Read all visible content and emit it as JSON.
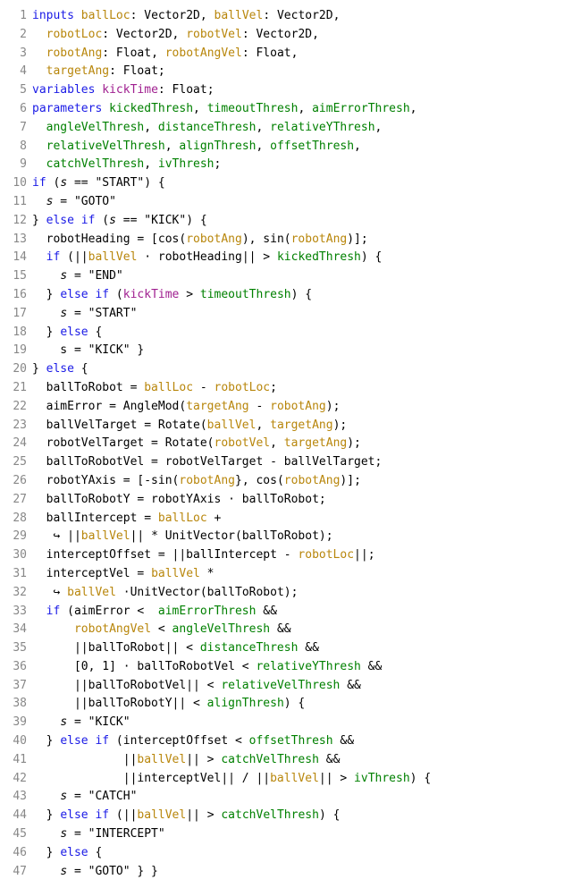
{
  "lines": [
    {
      "n": "1",
      "tokens": [
        [
          "kw",
          "inputs"
        ],
        [
          "txt",
          " "
        ],
        [
          "name",
          "ballLoc"
        ],
        [
          "txt",
          ": Vector2D, "
        ],
        [
          "name",
          "ballVel"
        ],
        [
          "txt",
          ": Vector2D,"
        ]
      ]
    },
    {
      "n": "2",
      "tokens": [
        [
          "txt",
          "  "
        ],
        [
          "name",
          "robotLoc"
        ],
        [
          "txt",
          ": Vector2D, "
        ],
        [
          "name",
          "robotVel"
        ],
        [
          "txt",
          ": Vector2D,"
        ]
      ]
    },
    {
      "n": "3",
      "tokens": [
        [
          "txt",
          "  "
        ],
        [
          "name",
          "robotAng"
        ],
        [
          "txt",
          ": Float, "
        ],
        [
          "name",
          "robotAngVel"
        ],
        [
          "txt",
          ": Float,"
        ]
      ]
    },
    {
      "n": "4",
      "tokens": [
        [
          "txt",
          "  "
        ],
        [
          "name",
          "targetAng"
        ],
        [
          "txt",
          ": Float;"
        ]
      ]
    },
    {
      "n": "5",
      "tokens": [
        [
          "kw",
          "variables"
        ],
        [
          "txt",
          " "
        ],
        [
          "var",
          "kickTime"
        ],
        [
          "txt",
          ": Float;"
        ]
      ]
    },
    {
      "n": "6",
      "tokens": [
        [
          "kw",
          "parameters"
        ],
        [
          "txt",
          " "
        ],
        [
          "param",
          "kickedThresh"
        ],
        [
          "txt",
          ", "
        ],
        [
          "param",
          "timeoutThresh"
        ],
        [
          "txt",
          ", "
        ],
        [
          "param",
          "aimErrorThresh"
        ],
        [
          "txt",
          ","
        ]
      ]
    },
    {
      "n": "7",
      "tokens": [
        [
          "txt",
          "  "
        ],
        [
          "param",
          "angleVelThresh"
        ],
        [
          "txt",
          ", "
        ],
        [
          "param",
          "distanceThresh"
        ],
        [
          "txt",
          ", "
        ],
        [
          "param",
          "relativeYThresh"
        ],
        [
          "txt",
          ","
        ]
      ]
    },
    {
      "n": "8",
      "tokens": [
        [
          "txt",
          "  "
        ],
        [
          "param",
          "relativeVelThresh"
        ],
        [
          "txt",
          ", "
        ],
        [
          "param",
          "alignThresh"
        ],
        [
          "txt",
          ", "
        ],
        [
          "param",
          "offsetThresh"
        ],
        [
          "txt",
          ","
        ]
      ]
    },
    {
      "n": "9",
      "tokens": [
        [
          "txt",
          "  "
        ],
        [
          "param",
          "catchVelThresh"
        ],
        [
          "txt",
          ", "
        ],
        [
          "param",
          "ivThresh"
        ],
        [
          "txt",
          ";"
        ]
      ]
    },
    {
      "n": "10",
      "tokens": [
        [
          "kw",
          "if"
        ],
        [
          "txt",
          " ("
        ],
        [
          "it",
          "s"
        ],
        [
          "txt",
          " == \"START\") {"
        ]
      ]
    },
    {
      "n": "11",
      "tokens": [
        [
          "txt",
          "  "
        ],
        [
          "it",
          "s"
        ],
        [
          "txt",
          " = \"GOTO\""
        ]
      ]
    },
    {
      "n": "12",
      "tokens": [
        [
          "txt",
          "} "
        ],
        [
          "kw",
          "else if"
        ],
        [
          "txt",
          " ("
        ],
        [
          "it",
          "s"
        ],
        [
          "txt",
          " == \"KICK\") {"
        ]
      ]
    },
    {
      "n": "13",
      "tokens": [
        [
          "txt",
          "  robotHeading = [cos("
        ],
        [
          "name",
          "robotAng"
        ],
        [
          "txt",
          "), sin("
        ],
        [
          "name",
          "robotAng"
        ],
        [
          "txt",
          ")];"
        ]
      ]
    },
    {
      "n": "14",
      "tokens": [
        [
          "txt",
          "  "
        ],
        [
          "kw",
          "if"
        ],
        [
          "txt",
          " (||"
        ],
        [
          "name",
          "ballVel"
        ],
        [
          "txt",
          " · robotHeading|| > "
        ],
        [
          "param",
          "kickedThresh"
        ],
        [
          "txt",
          ") {"
        ]
      ]
    },
    {
      "n": "15",
      "tokens": [
        [
          "txt",
          "    "
        ],
        [
          "it",
          "s"
        ],
        [
          "txt",
          " = \"END\""
        ]
      ]
    },
    {
      "n": "16",
      "tokens": [
        [
          "txt",
          "  } "
        ],
        [
          "kw",
          "else if"
        ],
        [
          "txt",
          " ("
        ],
        [
          "var",
          "kickTime"
        ],
        [
          "txt",
          " > "
        ],
        [
          "param",
          "timeoutThresh"
        ],
        [
          "txt",
          ") {"
        ]
      ]
    },
    {
      "n": "17",
      "tokens": [
        [
          "txt",
          "    "
        ],
        [
          "it",
          "s"
        ],
        [
          "txt",
          " = \"START\""
        ]
      ]
    },
    {
      "n": "18",
      "tokens": [
        [
          "txt",
          "  } "
        ],
        [
          "kw",
          "else"
        ],
        [
          "txt",
          " {"
        ]
      ]
    },
    {
      "n": "19",
      "tokens": [
        [
          "txt",
          "    s = \"KICK\" }"
        ]
      ]
    },
    {
      "n": "20",
      "tokens": [
        [
          "txt",
          "} "
        ],
        [
          "kw",
          "else"
        ],
        [
          "txt",
          " {"
        ]
      ]
    },
    {
      "n": "21",
      "tokens": [
        [
          "txt",
          "  ballToRobot = "
        ],
        [
          "name",
          "ballLoc"
        ],
        [
          "txt",
          " - "
        ],
        [
          "name",
          "robotLoc"
        ],
        [
          "txt",
          ";"
        ]
      ]
    },
    {
      "n": "22",
      "tokens": [
        [
          "txt",
          "  aimError = AngleMod("
        ],
        [
          "name",
          "targetAng"
        ],
        [
          "txt",
          " - "
        ],
        [
          "name",
          "robotAng"
        ],
        [
          "txt",
          ");"
        ]
      ]
    },
    {
      "n": "23",
      "tokens": [
        [
          "txt",
          "  ballVelTarget = Rotate("
        ],
        [
          "name",
          "ballVel"
        ],
        [
          "txt",
          ", "
        ],
        [
          "name",
          "targetAng"
        ],
        [
          "txt",
          ");"
        ]
      ]
    },
    {
      "n": "24",
      "tokens": [
        [
          "txt",
          "  robotVelTarget = Rotate("
        ],
        [
          "name",
          "robotVel"
        ],
        [
          "txt",
          ", "
        ],
        [
          "name",
          "targetAng"
        ],
        [
          "txt",
          ");"
        ]
      ]
    },
    {
      "n": "25",
      "tokens": [
        [
          "txt",
          "  ballToRobotVel = robotVelTarget - ballVelTarget;"
        ]
      ]
    },
    {
      "n": "26",
      "tokens": [
        [
          "txt",
          "  robotYAxis = [-sin("
        ],
        [
          "name",
          "robotAng"
        ],
        [
          "txt",
          "}, cos("
        ],
        [
          "name",
          "robotAng"
        ],
        [
          "txt",
          ")];"
        ]
      ]
    },
    {
      "n": "27",
      "tokens": [
        [
          "txt",
          "  ballToRobotY = robotYAxis · ballToRobot;"
        ]
      ]
    },
    {
      "n": "28",
      "tokens": [
        [
          "txt",
          "  ballIntercept = "
        ],
        [
          "name",
          "ballLoc"
        ],
        [
          "txt",
          " +"
        ]
      ]
    },
    {
      "n": "29",
      "tokens": [
        [
          "txt",
          "   ↪ ||"
        ],
        [
          "name",
          "ballVel"
        ],
        [
          "txt",
          "|| * UnitVector(ballToRobot);"
        ]
      ]
    },
    {
      "n": "30",
      "tokens": [
        [
          "txt",
          "  interceptOffset = ||ballIntercept - "
        ],
        [
          "name",
          "robotLoc"
        ],
        [
          "txt",
          "||;"
        ]
      ]
    },
    {
      "n": "31",
      "tokens": [
        [
          "txt",
          "  interceptVel = "
        ],
        [
          "name",
          "ballVel"
        ],
        [
          "txt",
          " *"
        ]
      ]
    },
    {
      "n": "32",
      "tokens": [
        [
          "txt",
          "   ↪ "
        ],
        [
          "name",
          "ballVel"
        ],
        [
          "txt",
          " ·UnitVector(ballToRobot);"
        ]
      ]
    },
    {
      "n": "33",
      "tokens": [
        [
          "txt",
          "  "
        ],
        [
          "kw",
          "if"
        ],
        [
          "txt",
          " (aimError <  "
        ],
        [
          "param",
          "aimErrorThresh"
        ],
        [
          "txt",
          " &&"
        ]
      ]
    },
    {
      "n": "34",
      "tokens": [
        [
          "txt",
          "      "
        ],
        [
          "name",
          "robotAngVel"
        ],
        [
          "txt",
          " < "
        ],
        [
          "param",
          "angleVelThresh"
        ],
        [
          "txt",
          " &&"
        ]
      ]
    },
    {
      "n": "35",
      "tokens": [
        [
          "txt",
          "      ||ballToRobot|| < "
        ],
        [
          "param",
          "distanceThresh"
        ],
        [
          "txt",
          " &&"
        ]
      ]
    },
    {
      "n": "36",
      "tokens": [
        [
          "txt",
          "      [0, 1] · ballToRobotVel < "
        ],
        [
          "param",
          "relativeYThresh"
        ],
        [
          "txt",
          " &&"
        ]
      ]
    },
    {
      "n": "37",
      "tokens": [
        [
          "txt",
          "      ||ballToRobotVel|| < "
        ],
        [
          "param",
          "relativeVelThresh"
        ],
        [
          "txt",
          " &&"
        ]
      ]
    },
    {
      "n": "38",
      "tokens": [
        [
          "txt",
          "      ||ballToRobotY|| < "
        ],
        [
          "param",
          "alignThresh"
        ],
        [
          "txt",
          ") {"
        ]
      ]
    },
    {
      "n": "39",
      "tokens": [
        [
          "txt",
          "    "
        ],
        [
          "it",
          "s"
        ],
        [
          "txt",
          " = \"KICK\""
        ]
      ]
    },
    {
      "n": "40",
      "tokens": [
        [
          "txt",
          "  } "
        ],
        [
          "kw",
          "else if"
        ],
        [
          "txt",
          " (interceptOffset < "
        ],
        [
          "param",
          "offsetThresh"
        ],
        [
          "txt",
          " &&"
        ]
      ]
    },
    {
      "n": "41",
      "tokens": [
        [
          "txt",
          "             ||"
        ],
        [
          "name",
          "ballVel"
        ],
        [
          "txt",
          "|| > "
        ],
        [
          "param",
          "catchVelThresh"
        ],
        [
          "txt",
          " &&"
        ]
      ]
    },
    {
      "n": "42",
      "tokens": [
        [
          "txt",
          "             ||interceptVel|| / ||"
        ],
        [
          "name",
          "ballVel"
        ],
        [
          "txt",
          "|| > "
        ],
        [
          "param",
          "ivThresh"
        ],
        [
          "txt",
          ") {"
        ]
      ]
    },
    {
      "n": "43",
      "tokens": [
        [
          "txt",
          "    "
        ],
        [
          "it",
          "s"
        ],
        [
          "txt",
          " = \"CATCH\""
        ]
      ]
    },
    {
      "n": "44",
      "tokens": [
        [
          "txt",
          "  } "
        ],
        [
          "kw",
          "else if"
        ],
        [
          "txt",
          " (||"
        ],
        [
          "name",
          "ballVel"
        ],
        [
          "txt",
          "|| > "
        ],
        [
          "param",
          "catchVelThresh"
        ],
        [
          "txt",
          ") {"
        ]
      ]
    },
    {
      "n": "45",
      "tokens": [
        [
          "txt",
          "    "
        ],
        [
          "it",
          "s"
        ],
        [
          "txt",
          " = \"INTERCEPT\""
        ]
      ]
    },
    {
      "n": "46",
      "tokens": [
        [
          "txt",
          "  } "
        ],
        [
          "kw",
          "else"
        ],
        [
          "txt",
          " {"
        ]
      ]
    },
    {
      "n": "47",
      "tokens": [
        [
          "txt",
          "    "
        ],
        [
          "it",
          "s"
        ],
        [
          "txt",
          " = \"GOTO\" } }"
        ]
      ]
    }
  ]
}
